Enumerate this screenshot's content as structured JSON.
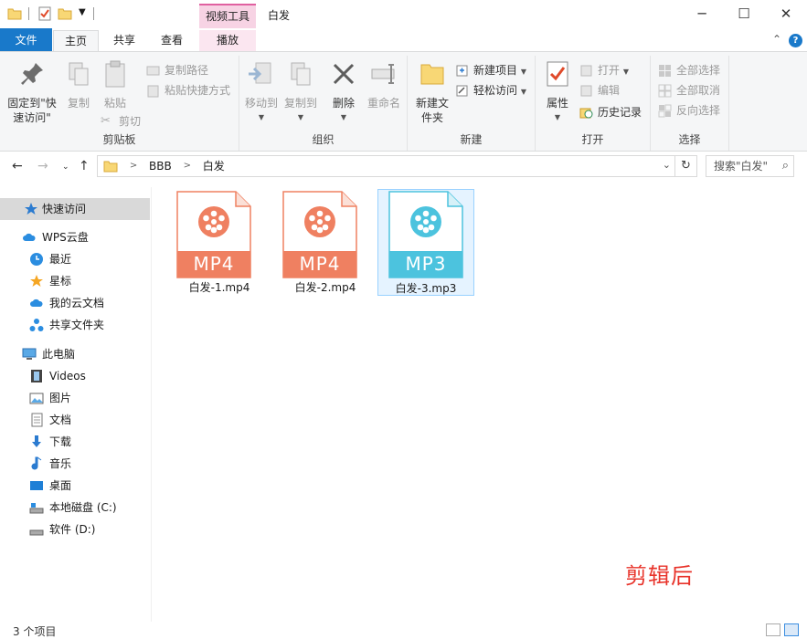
{
  "titlebar": {
    "context_tab": "视频工具",
    "title": "白发",
    "minimize": "─",
    "maximize": "☐",
    "close": "✕"
  },
  "ribbon_tabs": {
    "file": "文件",
    "home": "主页",
    "share": "共享",
    "view": "查看",
    "play": "播放",
    "collapse": "⌃",
    "help": "?"
  },
  "ribbon": {
    "clipboard": {
      "label": "剪贴板",
      "pin": "固定到\"快速访问\"",
      "copy": "复制",
      "paste": "粘贴",
      "copy_path": "复制路径",
      "paste_shortcut": "粘贴快捷方式",
      "cut": "剪切"
    },
    "organize": {
      "label": "组织",
      "move_to": "移动到",
      "copy_to": "复制到",
      "delete": "删除",
      "rename": "重命名"
    },
    "new": {
      "label": "新建",
      "new_folder": "新建文件夹",
      "new_item": "新建项目",
      "easy_access": "轻松访问"
    },
    "open": {
      "label": "打开",
      "properties": "属性",
      "open": "打开",
      "edit": "编辑",
      "history": "历史记录"
    },
    "select": {
      "label": "选择",
      "select_all": "全部选择",
      "select_none": "全部取消",
      "invert": "反向选择"
    }
  },
  "address": {
    "crumbs": [
      "BBB",
      "白发"
    ],
    "search_placeholder": "搜索\"白发\""
  },
  "nav": {
    "quick_access": "快速访问",
    "wps_cloud": "WPS云盘",
    "recent": "最近",
    "starred": "星标",
    "my_cloud_docs": "我的云文档",
    "shared_folders": "共享文件夹",
    "this_pc": "此电脑",
    "videos": "Videos",
    "pictures": "图片",
    "documents": "文档",
    "downloads": "下载",
    "music": "音乐",
    "desktop": "桌面",
    "local_disk": "本地磁盘 (C:)",
    "software": "软件 (D:)"
  },
  "files": [
    {
      "name": "白发-1.mp4",
      "badge": "MP4",
      "color": "#ef8061"
    },
    {
      "name": "白发-2.mp4",
      "badge": "MP4",
      "color": "#ef8061"
    },
    {
      "name": "白发-3.mp3",
      "badge": "MP3",
      "color": "#4cc3de"
    }
  ],
  "watermark": "剪辑后",
  "status": {
    "count": "3 个项目"
  },
  "colors": {
    "accent": "#1979ca",
    "context_tab": "#f7d3e4",
    "selection": "#e5f3ff"
  }
}
